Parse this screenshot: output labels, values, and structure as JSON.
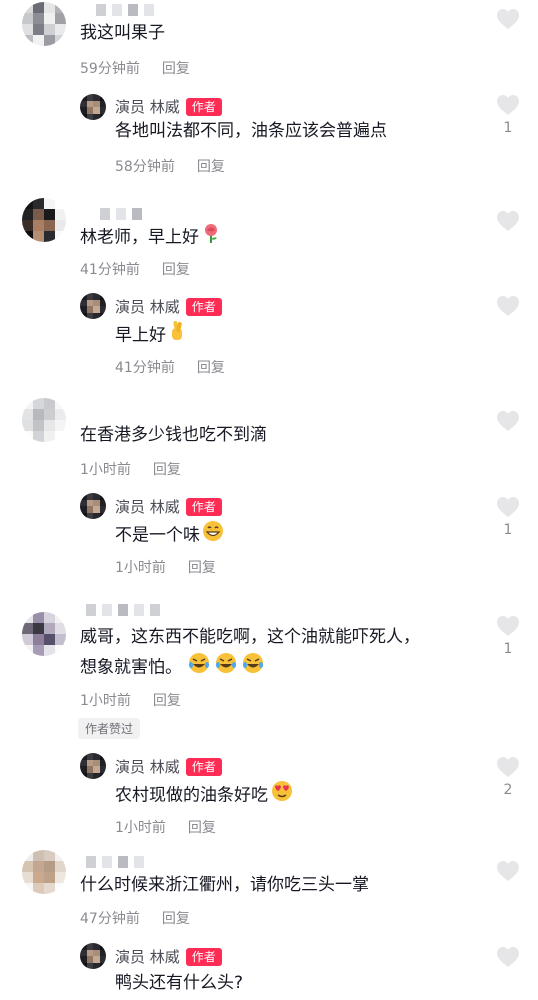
{
  "author": {
    "name": "演员 林威",
    "tag": "作者"
  },
  "reply_label": "回复",
  "author_liked_badge": "作者赞过",
  "comments": [
    {
      "text": "我这叫果子",
      "time": "59分钟前",
      "reply": {
        "text": "各地叫法都不同，油条应该会普遍点",
        "time": "58分钟前",
        "likes": "1"
      }
    },
    {
      "text": "林老师，早上好",
      "emoji": "rose-emoji",
      "time": "41分钟前",
      "reply": {
        "text": "早上好",
        "emoji": "crossed-fingers-emoji",
        "time": "41分钟前",
        "likes": ""
      }
    },
    {
      "text": "在香港多少钱也吃不到滴",
      "time": "1小时前",
      "reply": {
        "text": "不是一个味",
        "emoji": "grinning-emoji",
        "time": "1小时前",
        "likes": "1"
      }
    },
    {
      "text_line1": "威哥，这东西不能吃啊，这个油就能吓死人，",
      "text_line2": "想象就害怕。",
      "emoji": "laughing-tears-emoji",
      "time": "1小时前",
      "likes": "1",
      "reply": {
        "text": "农村现做的油条好吃",
        "emoji": "heart-eyes-emoji",
        "time": "1小时前",
        "likes": "2"
      }
    },
    {
      "text": "什么时候来浙江衢州，请你吃三头一掌",
      "time": "47分钟前",
      "reply": {
        "text": "鸭头还有什么头?"
      }
    }
  ]
}
